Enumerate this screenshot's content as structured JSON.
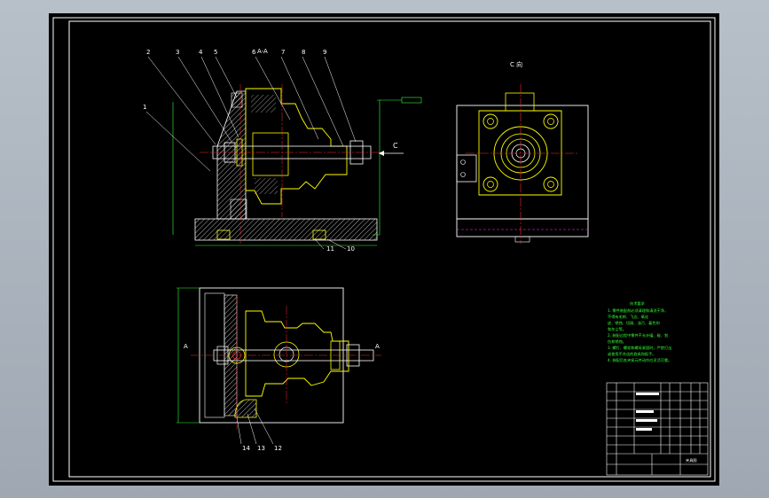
{
  "colors": {
    "background": "#000000",
    "frame": "#ffffff",
    "part": "#ffff00",
    "centerline": "#ff2a2a",
    "dimension": "#33ff33",
    "hatch": "#ffffff",
    "hidden": "#ff33ff"
  },
  "section_label": "A-A",
  "view_label": "C 向",
  "view_arrow_label": "C",
  "cut_letter_left": "A",
  "cut_letter_right": "A",
  "balloons_top": [
    "2",
    "3",
    "4",
    "5",
    "6",
    "7",
    "8",
    "9"
  ],
  "balloon_left": "1",
  "balloons_bottom": [
    "11",
    "10"
  ],
  "balloons_plan": [
    "14",
    "13",
    "12"
  ],
  "tech_requirements": {
    "title": "技术要求",
    "lines": [
      "1. 零件装配前必须清理和清洗干净，",
      "不得有毛刺、飞边、氧化",
      "皮、锈蚀、切屑、油污、着色剂",
      "和灰尘等。",
      "2. 装配过程中零件不允许磕、碰、划",
      "伤和锈蚀。",
      "3. 螺钉、螺栓和螺母紧固时，严禁打击",
      "或使用不合适的旋具和扳手。",
      "4. 装配后各夹紧元件动作应灵活可靠。"
    ]
  },
  "title_block": {
    "drawing_name": "夹具图"
  }
}
